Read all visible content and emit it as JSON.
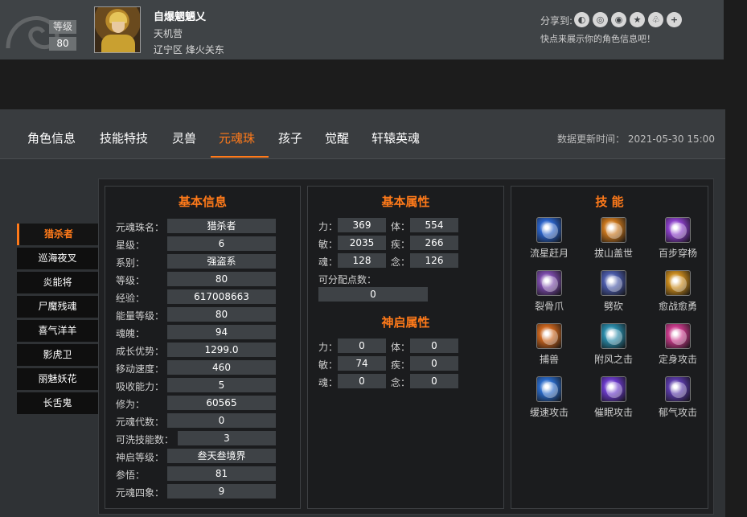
{
  "profile": {
    "level_label": "等级",
    "level_value": "80",
    "name": "自爆魍魉乂",
    "camp": "天机营",
    "server": "辽宁区 烽火关东",
    "share_label": "分享到:",
    "share_icons": [
      "wechat-icon",
      "qq-icon",
      "weibo-icon",
      "qzone-icon",
      "tieba-icon",
      "plus-icon"
    ],
    "share_tip": "快点来展示你的角色信息吧！"
  },
  "tabs": [
    {
      "label": "角色信息"
    },
    {
      "label": "技能特技"
    },
    {
      "label": "灵兽"
    },
    {
      "label": "元魂珠"
    },
    {
      "label": "孩子"
    },
    {
      "label": "觉醒"
    },
    {
      "label": "轩辕英魂"
    }
  ],
  "active_tab": "元魂珠",
  "update_time": "数据更新时间： 2021-05-30 15:00",
  "soul_list": [
    {
      "label": "猎杀者"
    },
    {
      "label": "巡海夜叉"
    },
    {
      "label": "炎能将"
    },
    {
      "label": "尸魔残魂"
    },
    {
      "label": "喜气洋羊"
    },
    {
      "label": "影虎卫"
    },
    {
      "label": "丽魅妖花"
    },
    {
      "label": "长舌鬼"
    }
  ],
  "basic_info": {
    "title": "基本信息",
    "rows": [
      {
        "label": "元魂珠名：",
        "value": "猎杀者"
      },
      {
        "label": "星级：",
        "value": "6"
      },
      {
        "label": "系别：",
        "value": "强盗系"
      },
      {
        "label": "等级：",
        "value": "80"
      },
      {
        "label": "经验：",
        "value": "617008663"
      },
      {
        "label": "能量等级：",
        "value": "80"
      },
      {
        "label": "魂魄：",
        "value": "94"
      },
      {
        "label": "成长优势：",
        "value": "1299.0"
      },
      {
        "label": "移动速度：",
        "value": "460"
      },
      {
        "label": "吸收能力：",
        "value": "5"
      },
      {
        "label": "修为：",
        "value": "60565"
      },
      {
        "label": "元魂代数：",
        "value": "0"
      },
      {
        "label": "可洗技能数：",
        "value": "3"
      },
      {
        "label": "神启等级：",
        "value": "叁天叁境界"
      },
      {
        "label": "参悟：",
        "value": "81"
      },
      {
        "label": "元魂四象：",
        "value": "9"
      }
    ]
  },
  "basic_attr": {
    "title": "基本属性",
    "rows": [
      {
        "l1": "力：",
        "v1": "369",
        "l2": "体：",
        "v2": "554"
      },
      {
        "l1": "敏：",
        "v1": "2035",
        "l2": "疾：",
        "v2": "266"
      },
      {
        "l1": "魂：",
        "v1": "128",
        "l2": "念：",
        "v2": "126"
      }
    ],
    "free_points_label": "可分配点数：",
    "free_points": "0"
  },
  "divine_attr": {
    "title": "神启属性",
    "rows": [
      {
        "l1": "力：",
        "v1": "0",
        "l2": "体：",
        "v2": "0"
      },
      {
        "l1": "敏：",
        "v1": "74",
        "l2": "疾：",
        "v2": "0"
      },
      {
        "l1": "魂：",
        "v1": "0",
        "l2": "念：",
        "v2": "0"
      }
    ]
  },
  "skills": {
    "title": "技 能",
    "items": [
      {
        "name": "流星赶月",
        "icon": "swirl-icon",
        "color": "#2a62c8"
      },
      {
        "name": "拔山盖世",
        "icon": "mountain-icon",
        "color": "#c8761e"
      },
      {
        "name": "百步穿杨",
        "icon": "arrow-icon",
        "color": "#8a3fc8"
      },
      {
        "name": "裂骨爪",
        "icon": "claw-icon",
        "color": "#7a4aa8"
      },
      {
        "name": "劈砍",
        "icon": "slash-icon",
        "color": "#4a5aa8"
      },
      {
        "name": "愈战愈勇",
        "icon": "rage-icon",
        "color": "#c88a1e"
      },
      {
        "name": "捕兽",
        "icon": "trap-icon",
        "color": "#c8641e"
      },
      {
        "name": "附风之击",
        "icon": "wind-icon",
        "color": "#2a8aa8"
      },
      {
        "name": "定身攻击",
        "icon": "bind-icon",
        "color": "#c83a8a"
      },
      {
        "name": "缓速攻击",
        "icon": "slow-icon",
        "color": "#2a6ac8"
      },
      {
        "name": "催眠攻击",
        "icon": "sleep-icon",
        "color": "#6a3ac8"
      },
      {
        "name": "郁气攻击",
        "icon": "gloom-icon",
        "color": "#5a3aa8"
      }
    ]
  }
}
